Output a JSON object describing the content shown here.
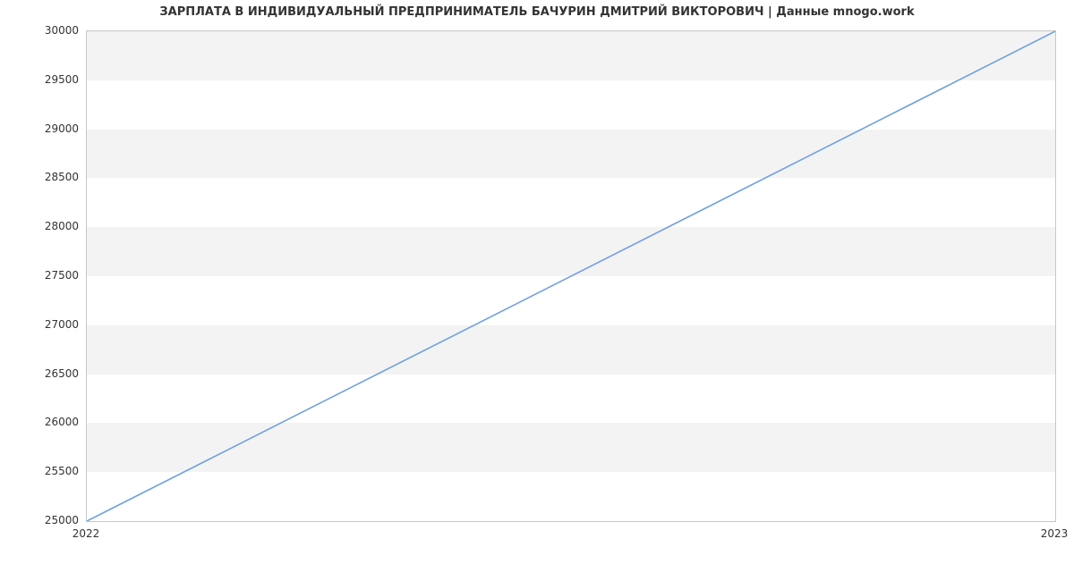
{
  "chart_data": {
    "type": "line",
    "title": "ЗАРПЛАТА В ИНДИВИДУАЛЬНЫЙ ПРЕДПРИНИМАТЕЛЬ БАЧУРИН ДМИТРИЙ ВИКТОРОВИЧ | Данные mnogo.work",
    "x": [
      2022,
      2023
    ],
    "values": [
      25000,
      30000
    ],
    "xlabel": "",
    "ylabel": "",
    "xlim": [
      2022,
      2023
    ],
    "ylim": [
      25000,
      30000
    ],
    "x_ticks": [
      2022,
      2023
    ],
    "y_ticks": [
      25000,
      25500,
      26000,
      26500,
      27000,
      27500,
      28000,
      28500,
      29000,
      29500,
      30000
    ],
    "x_tick_labels": [
      "2022",
      "2023"
    ],
    "y_tick_labels": [
      "25000",
      "25500",
      "26000",
      "26500",
      "27000",
      "27500",
      "28000",
      "28500",
      "29000",
      "29500",
      "30000"
    ],
    "line_color": "#6f9fe1",
    "band_color": "#f3f3f3",
    "plot_border_color": "#c7c7c7"
  }
}
